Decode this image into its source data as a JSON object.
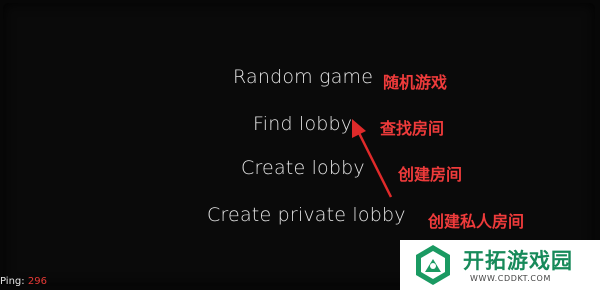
{
  "menu": {
    "items": [
      {
        "label": "Random game",
        "note": "随机游戏"
      },
      {
        "label": "Find lobby",
        "note": "查找房间"
      },
      {
        "label": "Create lobby",
        "note": "创建房间"
      },
      {
        "label": "Create private lobby",
        "note": "创建私人房间"
      }
    ]
  },
  "status": {
    "ping_label": "Ping:",
    "ping_value": "296"
  },
  "watermark": {
    "title": "开拓游戏园",
    "url": "WWW.CDDKT.COM"
  },
  "colors": {
    "background": "#070707",
    "menu_text": "#e4e4e4",
    "annotation": "#ee3b3b",
    "ping_value": "#e53935",
    "watermark_green": "#178a5a"
  }
}
